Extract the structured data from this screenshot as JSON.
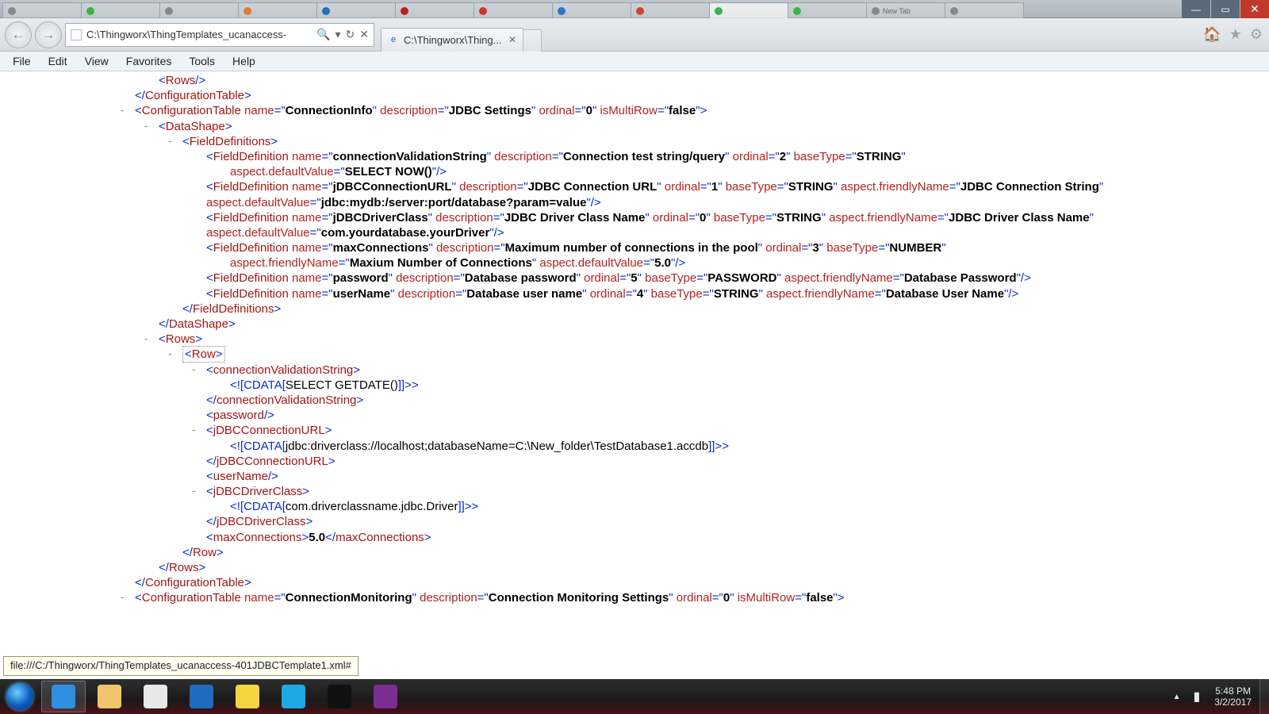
{
  "window": {
    "inactive_tabs": [
      {
        "color": "#888",
        "label": ""
      },
      {
        "color": "#3cb24a",
        "label": ""
      },
      {
        "color": "#888",
        "label": ""
      },
      {
        "color": "#e07b2f",
        "label": ""
      },
      {
        "color": "#1e6ec0",
        "label": ""
      },
      {
        "color": "#b22",
        "label": ""
      },
      {
        "color": "#d03232",
        "label": ""
      },
      {
        "color": "#2f75c9",
        "label": ""
      },
      {
        "color": "#c43",
        "label": ""
      },
      {
        "color": "#3cb24a",
        "label": "",
        "active": true
      },
      {
        "color": "#3cb24a",
        "label": ""
      },
      {
        "color": "#888",
        "label": "New Tab"
      },
      {
        "color": "#888",
        "label": ""
      }
    ]
  },
  "ie": {
    "address": "C:\\Thingworx\\ThingTemplates_ucanaccess-",
    "search_glyph": "🔍",
    "dropdown_glyph": "▾",
    "refresh_glyph": "↻",
    "stop_glyph": "✕",
    "tab_label": "C:\\Thingworx\\Thing...",
    "home_glyph": "🏠",
    "fav_glyph": "★",
    "gear_glyph": "⚙"
  },
  "menu": {
    "file": "File",
    "edit": "Edit",
    "view": "View",
    "favorites": "Favorites",
    "tools": "Tools",
    "help": "Help"
  },
  "xml": {
    "rows_open": "Rows",
    "conf_table_close": "ConfigurationTable",
    "ct": {
      "el": "ConfigurationTable",
      "attrs": {
        "name": "ConnectionInfo",
        "description": "JDBC Settings",
        "ordinal": "0",
        "isMultiRow": "false"
      }
    },
    "datashape": "DataShape",
    "fielddefs": "FieldDefinitions",
    "fd_el": "FieldDefinition",
    "fd1": {
      "name": "connectionValidationString",
      "description": "Connection test string/query",
      "ordinal": "2",
      "baseType": "STRING",
      "def": "SELECT NOW()"
    },
    "fd2": {
      "name": "jDBCConnectionURL",
      "description": "JDBC Connection URL",
      "ordinal": "1",
      "baseType": "STRING",
      "friendly": "JDBC Connection String",
      "def": "jdbc:mydb:/server:port/database?param=value"
    },
    "fd3": {
      "name": "jDBCDriverClass",
      "description": "JDBC Driver Class Name",
      "ordinal": "0",
      "baseType": "STRING",
      "friendly": "JDBC Driver Class Name",
      "def": "com.yourdatabase.yourDriver"
    },
    "fd4": {
      "name": "maxConnections",
      "description": "Maximum number of connections in the pool",
      "ordinal": "3",
      "baseType": "NUMBER",
      "friendly": "Maxium Number of Connections",
      "def": "5.0"
    },
    "fd5": {
      "name": "password",
      "description": "Database password",
      "ordinal": "5",
      "baseType": "PASSWORD",
      "friendly": "Database Password"
    },
    "fd6": {
      "name": "userName",
      "description": "Database user name",
      "ordinal": "4",
      "baseType": "STRING",
      "friendly": "Database User Name"
    },
    "rows": "Rows",
    "row": "Row",
    "cvstring": "connectionValidationString",
    "cv_cdata": "SELECT GETDATE()",
    "password": "password",
    "jdbcurl": "jDBCConnectionURL",
    "jdbcurl_cdata": "jdbc:driverclass://localhost;databaseName=C:\\New_folder\\TestDatabase1.accdb",
    "username": "userName",
    "jdbcdrv": "jDBCDriverClass",
    "jdbcdrv_cdata": "com.driverclassname.jdbc.Driver",
    "maxconn": "maxConnections",
    "maxconn_val": "5.0",
    "ct2": {
      "name": "ConnectionMonitoring",
      "description": "Connection Monitoring Settings",
      "ordinal": "0",
      "isMultiRow": "false"
    },
    "cdata_open": "<![CDATA[",
    "cdata_close": "]]>"
  },
  "status_tip": "file:///C:/Thingworx/ThingTemplates_ucanaccess-401JDBCTemplate1.xml#",
  "taskbar": {
    "items": [
      {
        "name": "internet-explorer",
        "color": "#2f8fe0",
        "active": true
      },
      {
        "name": "file-explorer",
        "color": "#f0c56a"
      },
      {
        "name": "chrome",
        "color": "#e8e8e8"
      },
      {
        "name": "outlook",
        "color": "#1e6bc0"
      },
      {
        "name": "sticky-notes",
        "color": "#f4d441"
      },
      {
        "name": "skype",
        "color": "#1fa8e6"
      },
      {
        "name": "cmd",
        "color": "#111"
      },
      {
        "name": "onenote",
        "color": "#7b2e91"
      }
    ],
    "time": "5:48 PM",
    "date": "3/2/2017"
  }
}
